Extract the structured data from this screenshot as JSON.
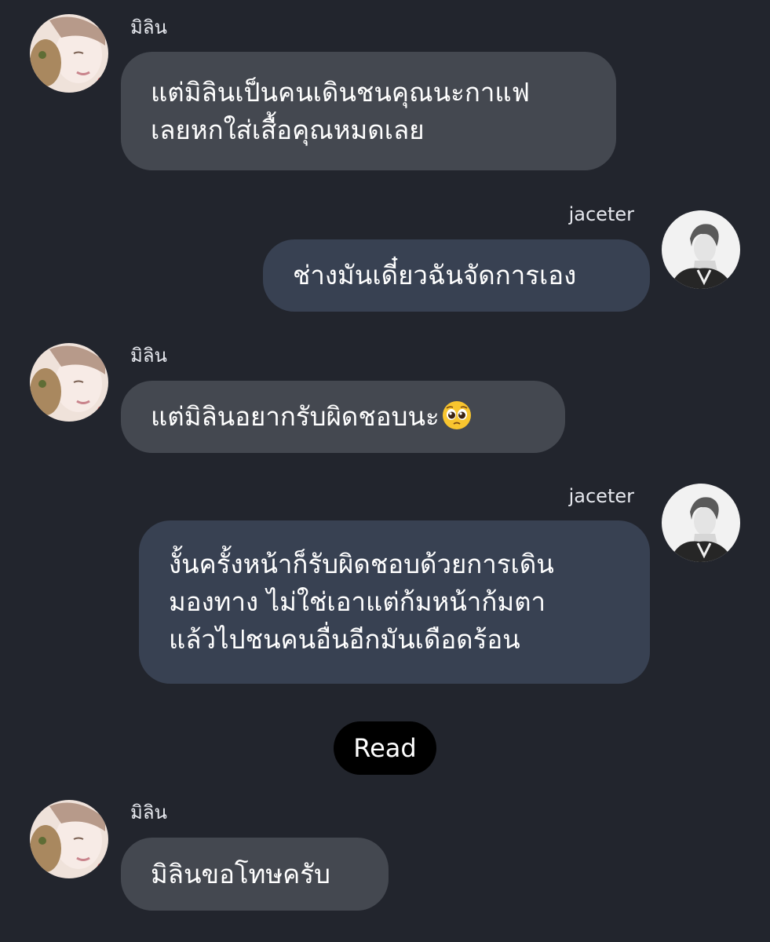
{
  "chat": {
    "messages": [
      {
        "sender": "มิลิน",
        "side": "left",
        "lines": [
          "แต่มิลินเป็นคนเดินชนคุณนะกาแฟ",
          "เลยหกใส่เสื้อคุณหมดเลย"
        ]
      },
      {
        "sender": "jaceter",
        "side": "right",
        "lines": [
          "ช่างมันเดี๋ยวฉันจัดการเอง"
        ]
      },
      {
        "sender": "มิลิน",
        "side": "left",
        "lines": [
          "แต่มิลินอยากรับผิดชอบนะ"
        ],
        "emoji": "pleading-face-emoji"
      },
      {
        "sender": "jaceter",
        "side": "right",
        "lines": [
          "งั้นครั้งหน้าก็รับผิดชอบด้วยการเดิน",
          "มองทาง ไม่ใช่เอาแต่ก้มหน้าก้มตา",
          "แล้วไปชนคนอื่นอีกมันเดือดร้อน"
        ]
      },
      {
        "sender": "มิลิน",
        "side": "left",
        "lines": [
          "มิลินขอโทษครับ"
        ]
      }
    ],
    "read_status": "Read"
  },
  "colors": {
    "background": "#22252d",
    "incoming_bubble": "#444850",
    "outgoing_bubble": "#384152",
    "read_pill": "#000000",
    "text": "#ffffff"
  }
}
